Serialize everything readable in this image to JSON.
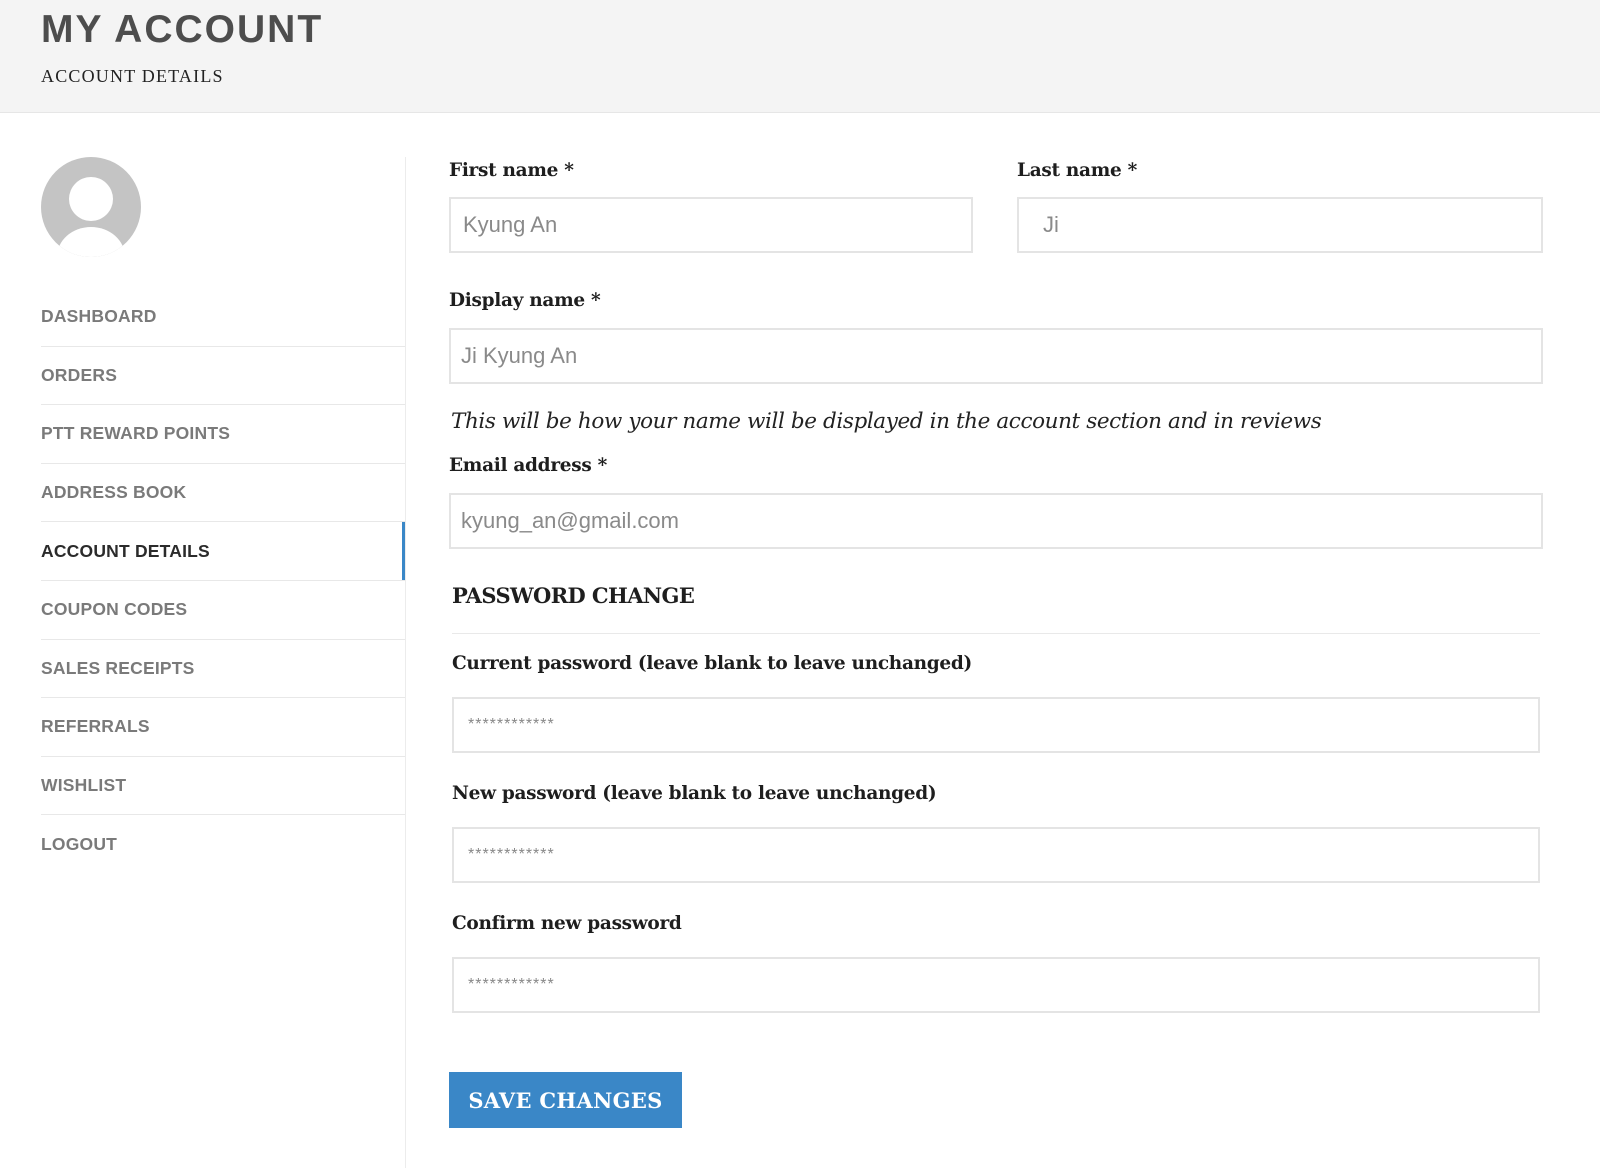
{
  "header": {
    "title": "MY ACCOUNT",
    "subtitle": "ACCOUNT DETAILS"
  },
  "sidebar": {
    "avatar_icon": "user-avatar-icon",
    "items": [
      {
        "label": "DASHBOARD",
        "active": false
      },
      {
        "label": "ORDERS",
        "active": false
      },
      {
        "label": "PTT REWARD POINTS",
        "active": false
      },
      {
        "label": "ADDRESS BOOK",
        "active": false
      },
      {
        "label": "ACCOUNT DETAILS",
        "active": true
      },
      {
        "label": "COUPON CODES",
        "active": false
      },
      {
        "label": "SALES RECEIPTS",
        "active": false
      },
      {
        "label": "REFERRALS",
        "active": false
      },
      {
        "label": "WISHLIST",
        "active": false
      },
      {
        "label": "LOGOUT",
        "active": false
      }
    ],
    "active_color": "#3a87c7"
  },
  "form": {
    "first_name": {
      "label": "First name *",
      "value": "Kyung An"
    },
    "last_name": {
      "label": "Last name *",
      "value": "Ji"
    },
    "display_name": {
      "label": "Display name *",
      "value": "Ji Kyung An",
      "hint": "This will be how your name will be displayed in the account section and in reviews"
    },
    "email": {
      "label": "Email address *",
      "value": "kyung_an@gmail.com"
    },
    "password_section": {
      "title": "PASSWORD CHANGE",
      "current": {
        "label": "Current password (leave blank to leave unchanged)",
        "value": "************"
      },
      "new": {
        "label": "New password (leave blank to leave unchanged)",
        "value": "************"
      },
      "confirm": {
        "label": "Confirm new password",
        "value": "************"
      }
    },
    "save_label": "SAVE CHANGES",
    "button_color": "#3a87c7"
  }
}
